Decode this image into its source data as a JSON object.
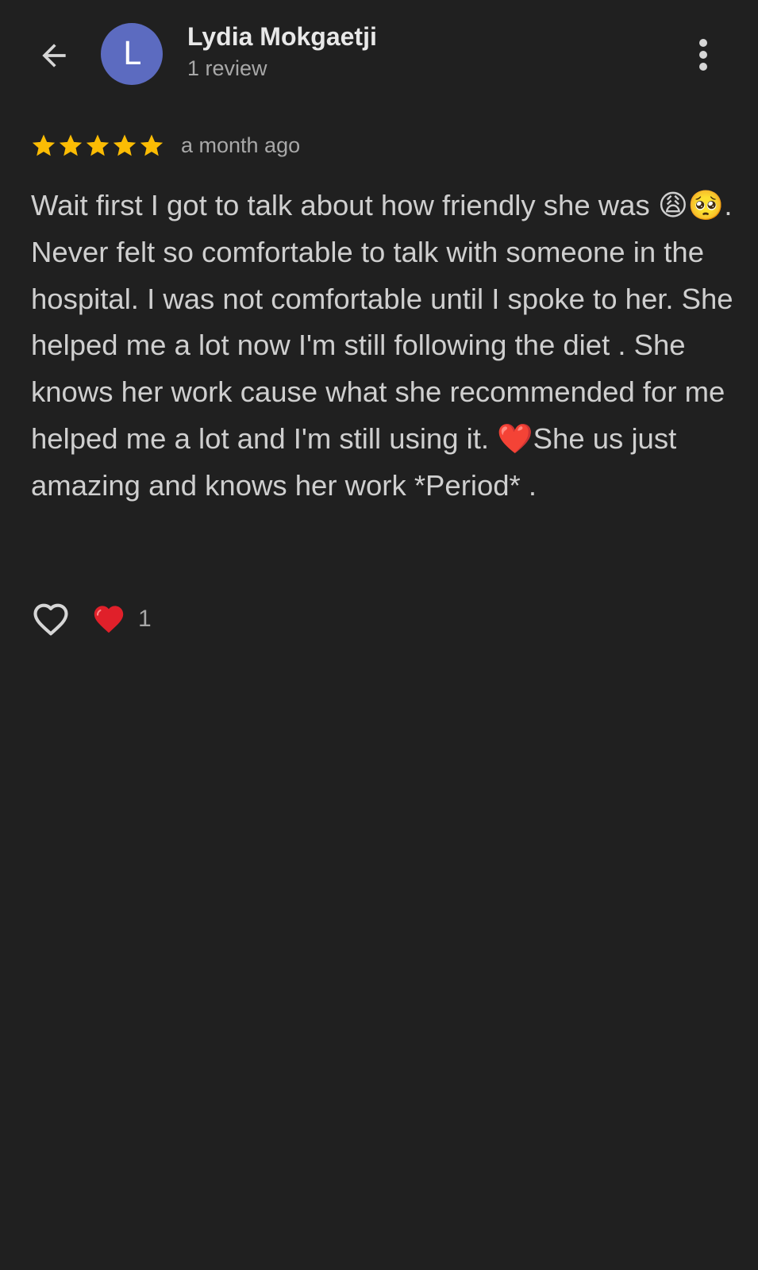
{
  "header": {
    "back_icon": "arrow-back-icon",
    "avatar_letter": "L",
    "avatar_color": "#5c6bc0",
    "reviewer_name": "Lydia Mokgaetji",
    "review_count": "1 review",
    "more_icon": "more-vertical-icon"
  },
  "review": {
    "rating": 5,
    "rating_max": 5,
    "star_color": "#fbbc04",
    "time_ago": "a month ago",
    "text_part1": "Wait first I got to talk about how friendly she was ",
    "emoji1": "😩🥺",
    "text_part2": ". Never felt so comfortable to talk with someone in the hospital. I was not comfortable until I spoke to her. She helped me a lot now I'm still following the diet . She knows her work cause what she recommended for me helped me a lot and I'm still using it. ",
    "emoji2": "❤️",
    "text_part3": "She us just amazing and knows her work *Period* ."
  },
  "actions": {
    "like_icon": "heart-outline-icon",
    "reaction_icon": "red-heart-icon",
    "reaction_count": "1"
  }
}
